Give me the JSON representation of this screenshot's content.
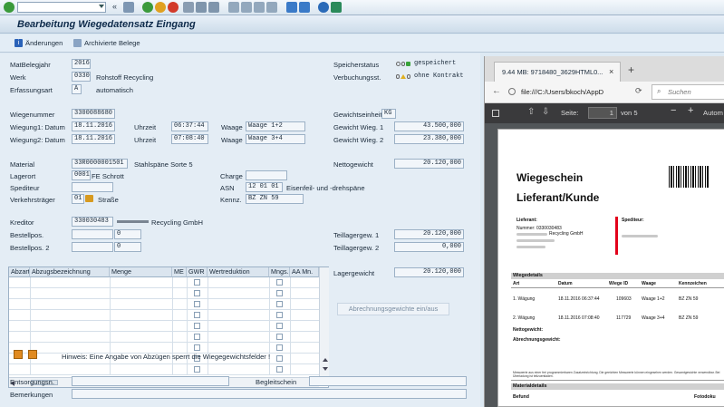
{
  "title": "Bearbeitung Wiegedatensatz Eingang",
  "toolbar": {
    "changes": "Änderungen",
    "archived": "Archivierte Belege"
  },
  "header": {
    "matbelegjahr_label": "MatBelegjahr",
    "matbelegjahr": "2016",
    "werk_label": "Werk",
    "werk": "0330",
    "werk_text": "Rohstoff Recycling",
    "erfassungsart_label": "Erfassungsart",
    "erfassungsart": "A",
    "erfassungsart_text": "automatisch",
    "speicherstatus_label": "Speicherstatus",
    "speicherstatus": "gespeichert",
    "verbuchungsst_label": "Verbuchungsst.",
    "verbuchungsst": "ohne Kontrakt"
  },
  "weigh": {
    "wiegenummer_label": "Wiegenummer",
    "wiegenummer": "3300088680",
    "w1_label": "Wiegung1: Datum",
    "w1_date": "18.11.2016",
    "w2_label": "Wiegung2: Datum",
    "w2_date": "18.11.2016",
    "uhrzeit_label": "Uhrzeit",
    "w1_time": "06:37:44",
    "w2_time": "07:08:40",
    "waage_label": "Waage",
    "w1_waage": "Waage 1+2",
    "w2_waage": "Waage 3+4",
    "einheit_label": "Gewichtseinheit",
    "einheit": "KG",
    "gw1_label": "Gewicht Wieg. 1",
    "gw1": "43.500,000",
    "gw2_label": "Gewicht Wieg. 2",
    "gw2": "23.380,000"
  },
  "material": {
    "material_label": "Material",
    "material": "33R0000001501",
    "material_text": "Stahlspäne Sorte 5",
    "lagerort_label": "Lagerort",
    "lagerort": "0001",
    "lagerort_text": "FE Schrott",
    "spediteur_label": "Spediteur",
    "verkehr_label": "Verkehrsträger",
    "verkehr": "01",
    "verkehr_text": "Straße",
    "charge_label": "Charge",
    "asn_label": "ASN",
    "asn": "12 01 01",
    "asn_text": "Eisenfeil- und -drehspäne",
    "kennz_label": "Kennz.",
    "kennz": "BZ ZN 59",
    "netto_label": "Nettogewicht",
    "netto": "20.120,000"
  },
  "creditor": {
    "kreditor_label": "Kreditor",
    "kreditor": "330030483",
    "kreditor_text": "Recycling GmbH",
    "best1_label": "Bestellpos.",
    "best1": "0",
    "best2_label": "Bestellpos. 2",
    "best2": "0",
    "teil1_label": "Teillagergew. 1",
    "teil1": "20.120,000",
    "teil2_label": "Teillagergew. 2",
    "teil2": "0,000"
  },
  "table": {
    "headers": [
      "Abzart",
      "Abzugsbezeichnung",
      "Menge",
      "ME",
      "GWR",
      "Wertreduktion",
      "Mngs.",
      "AA Mn."
    ]
  },
  "lager": {
    "label": "Lagergewicht",
    "value": "20.120,000",
    "button": "Abrechnungsgewichte ein/aus"
  },
  "hint": "Hinweis: Eine Angabe von Abzügen sperrt die Wiegegewichtsfelder !",
  "footer": {
    "entsorgung_label": "Entsorgungsn.",
    "begleit_label": "Begleitschein",
    "bemerk_label": "Bemerkungen"
  },
  "browser": {
    "tab_title": "9.44 MB: 9718480_3629HTML0...",
    "url": "file:///C:/Users/bkoch/AppD",
    "search_placeholder": "Suchen",
    "page_label": "Seite:",
    "page_num": "1",
    "page_of": "von 5",
    "zoom_text": "Autom"
  },
  "pdf": {
    "title1": "Wiegeschein",
    "title2": "Lieferant/Kunde",
    "lieferant_label": "Lieferant:",
    "nummer": "Nummer: 0330030483",
    "recycling": "Recycling GmbH",
    "spediteur_label": "Spediteur:",
    "details_title": "Wiegedetails",
    "cols": [
      "Art",
      "Datum",
      "Wiege ID",
      "Waage",
      "Kennzeichen"
    ],
    "rows": [
      [
        "1. Wägung",
        "18.11.2016 06:37:44",
        "109603",
        "Waage 1+2",
        "BZ ZN 59"
      ],
      [
        "2. Wägung",
        "18.11.2016 07:08:40",
        "117729",
        "Waage 3+4",
        "BZ ZN 59"
      ]
    ],
    "netto_label": "Nettogewicht:",
    "abrech_label": "Abrechnungsgewicht:",
    "note": "Messwerte aus einer frei programmierbaren Zusatzeinrichtung. Die geeichten Messwerte können eingesehen werden. Gesamtgewichte verwendbar. Bei Überladung ist teilzuentladen.",
    "material_title": "Materialdetails",
    "befund": "Befund",
    "fotodoku": "Fotodoku"
  }
}
